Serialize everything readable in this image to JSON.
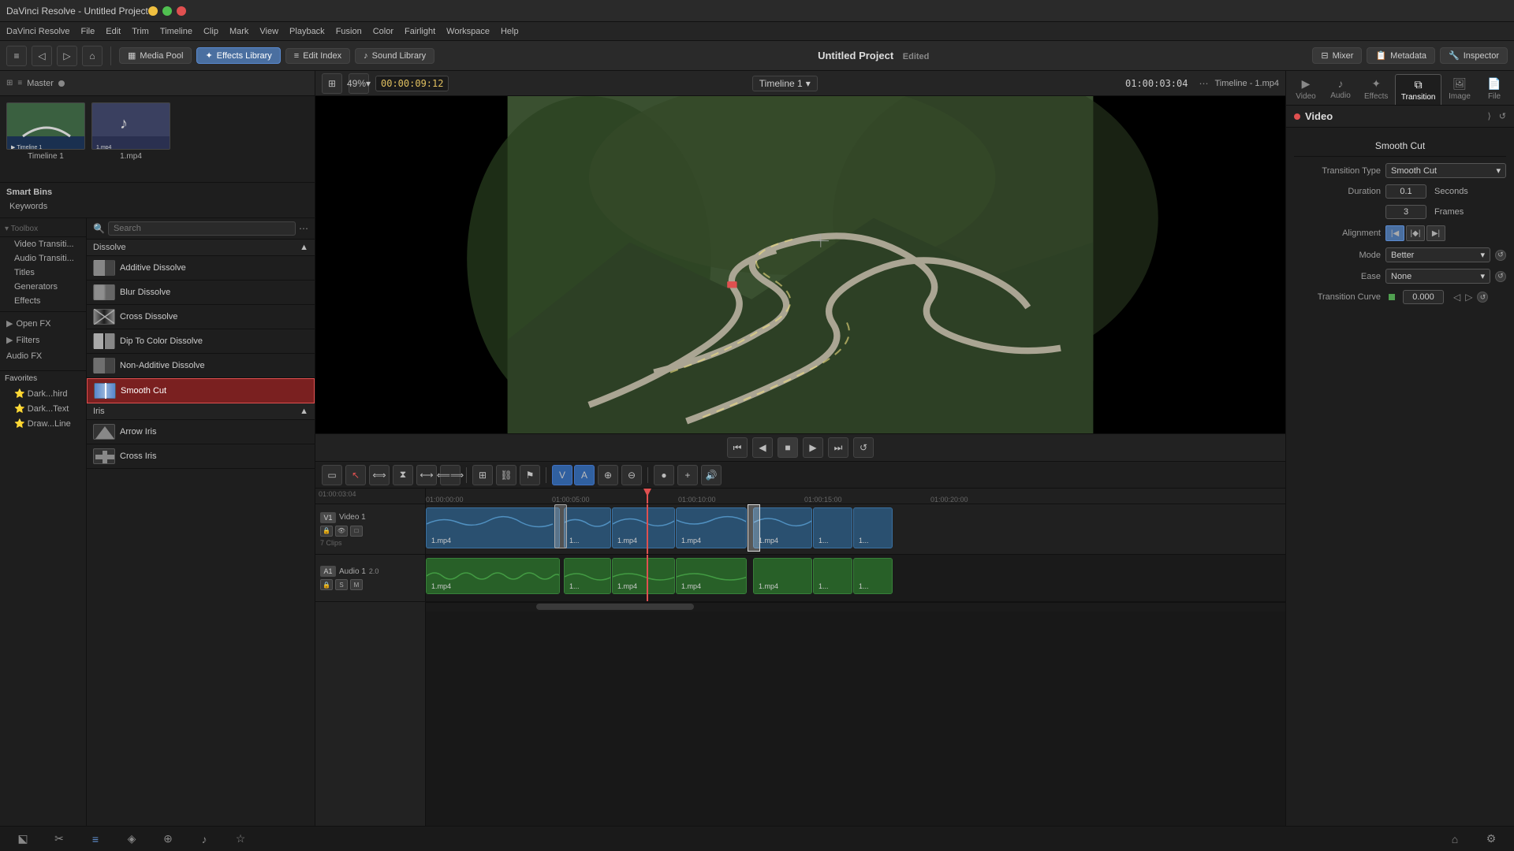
{
  "titlebar": {
    "title": "DaVinci Resolve - Untitled Project"
  },
  "menubar": {
    "items": [
      "DaVinci Resolve",
      "File",
      "Edit",
      "Trim",
      "Timeline",
      "Clip",
      "Mark",
      "View",
      "Playback",
      "Fusion",
      "Color",
      "Fairlight",
      "Workspace",
      "Help"
    ]
  },
  "topbar": {
    "media_pool": "Media Pool",
    "effects_library": "Effects Library",
    "edit_index": "Edit Index",
    "sound_library": "Sound Library",
    "project_title": "Untitled Project",
    "edited_label": "Edited",
    "mixer": "Mixer",
    "metadata": "Metadata",
    "inspector": "Inspector"
  },
  "preview": {
    "zoom": "49%",
    "timecode": "00:00:09:12",
    "timeline_name": "Timeline 1",
    "right_timecode": "01:00:03:04",
    "file_label": "Timeline - 1.mp4"
  },
  "media_pool": {
    "label": "Master",
    "items": [
      {
        "name": "Timeline 1",
        "type": "video"
      },
      {
        "name": "1.mp4",
        "type": "video_music"
      }
    ]
  },
  "smart_bins": {
    "title": "Smart Bins",
    "items": [
      "Keywords"
    ]
  },
  "effects_panel": {
    "title": "Effects",
    "search_placeholder": "Search",
    "toolbox_label": "Toolbox",
    "groups": [
      {
        "id": "video-transitions",
        "label": "Video Transiti...",
        "expanded": true
      },
      {
        "id": "audio-transitions",
        "label": "Audio Transiti...",
        "expanded": false
      },
      {
        "id": "titles",
        "label": "Titles",
        "expanded": false
      },
      {
        "id": "generators",
        "label": "Generators",
        "expanded": false
      },
      {
        "id": "effects",
        "label": "Effects",
        "expanded": false
      },
      {
        "id": "open-fx",
        "label": "Open FX",
        "expanded": false
      },
      {
        "id": "filters",
        "label": "Filters",
        "expanded": false
      },
      {
        "id": "audio-fx",
        "label": "Audio FX",
        "expanded": false
      }
    ],
    "dissolve_section": {
      "title": "Dissolve",
      "items": [
        {
          "name": "Additive Dissolve",
          "selected": false
        },
        {
          "name": "Blur Dissolve",
          "selected": false
        },
        {
          "name": "Cross Dissolve",
          "selected": false
        },
        {
          "name": "Dip To Color Dissolve",
          "selected": false
        },
        {
          "name": "Non-Additive Dissolve",
          "selected": false
        },
        {
          "name": "Smooth Cut",
          "selected": true
        }
      ]
    },
    "iris_section": {
      "title": "Iris",
      "items": [
        {
          "name": "Arrow Iris",
          "selected": false
        },
        {
          "name": "Cross Iris",
          "selected": false
        }
      ]
    },
    "favorites_section": {
      "title": "Favorites",
      "items": [
        {
          "name": "Dark...hird"
        },
        {
          "name": "Dark...Text"
        },
        {
          "name": "Draw...Line"
        }
      ]
    }
  },
  "inspector": {
    "tabs": [
      {
        "id": "video",
        "label": "Video",
        "icon": "▶"
      },
      {
        "id": "audio",
        "label": "Audio",
        "icon": "♪"
      },
      {
        "id": "effects",
        "label": "Effects",
        "icon": "✦"
      },
      {
        "id": "transition",
        "label": "Transition",
        "icon": "⧉",
        "active": true
      },
      {
        "id": "image",
        "label": "Image",
        "icon": "🖼"
      },
      {
        "id": "file",
        "label": "File",
        "icon": "📄"
      }
    ],
    "section_title": "Video",
    "transition_type_label": "Transition Type",
    "transition_type_value": "Smooth Cut",
    "transition_name_display": "Smooth Cut",
    "duration_label": "Duration",
    "duration_value": "0.1",
    "duration_unit": "Seconds",
    "frames_value": "3",
    "frames_unit": "Frames",
    "alignment_label": "Alignment",
    "mode_label": "Mode",
    "mode_value": "Better",
    "ease_label": "Ease",
    "ease_value": "None",
    "curve_label": "Transition Curve",
    "curve_value": "0.000"
  },
  "timeline": {
    "timecode": "01:00:03:04",
    "name": "Timeline 1",
    "tracks": {
      "video": {
        "label": "V1",
        "name": "Video 1"
      },
      "audio": {
        "label": "A1",
        "name": "Audio 1",
        "level": "2.0"
      }
    },
    "clips": [
      {
        "id": "v1",
        "label": "1.mp4",
        "type": "video"
      },
      {
        "id": "v2",
        "label": "1...",
        "type": "video"
      },
      {
        "id": "v3",
        "label": "1.mp4",
        "type": "video"
      },
      {
        "id": "v4",
        "label": "1.mp4",
        "type": "video"
      },
      {
        "id": "v5",
        "label": "1.mp4",
        "type": "video"
      },
      {
        "id": "v6",
        "label": "1...",
        "type": "video"
      },
      {
        "id": "v7",
        "label": "1...",
        "type": "video"
      }
    ],
    "clip_count": "7 Clips"
  },
  "bottom_bar": {
    "buttons": [
      "⬕",
      "⊡",
      "✂",
      "≡",
      "⊕",
      "♪",
      "☆",
      "⚙",
      "⌂",
      "⚙"
    ]
  }
}
